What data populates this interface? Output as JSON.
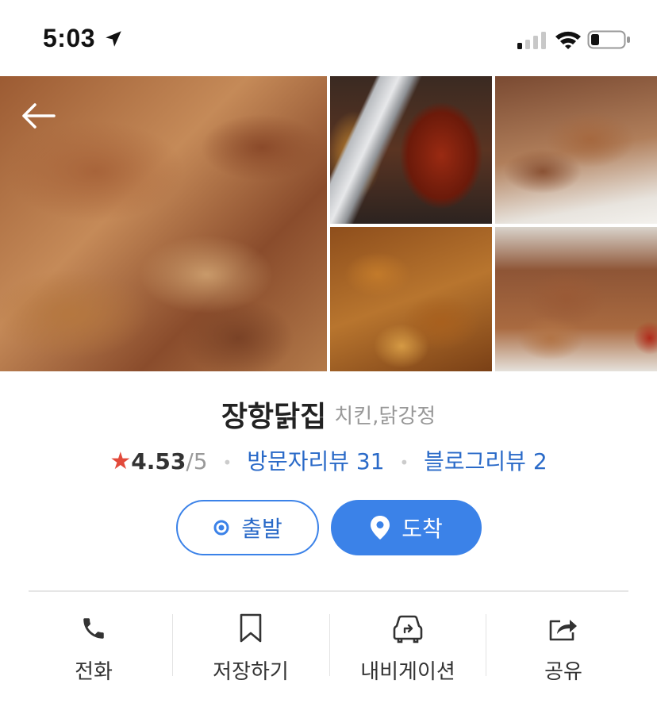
{
  "status_bar": {
    "time": "5:03"
  },
  "place": {
    "name": "장항닭집",
    "category": "치킨,닭강정",
    "rating": "4.53",
    "rating_max": "/5",
    "visitor_reviews": "방문자리뷰 31",
    "blog_reviews": "블로그리뷰 2"
  },
  "buttons": {
    "start": "출발",
    "arrive": "도착"
  },
  "actions": [
    {
      "label": "전화",
      "icon": "phone-icon"
    },
    {
      "label": "저장하기",
      "icon": "bookmark-icon"
    },
    {
      "label": "내비게이션",
      "icon": "car-navigation-icon"
    },
    {
      "label": "공유",
      "icon": "share-icon"
    }
  ],
  "colors": {
    "accent": "#3b82e8",
    "link": "#2a6ac8",
    "star": "#e24a3b"
  }
}
